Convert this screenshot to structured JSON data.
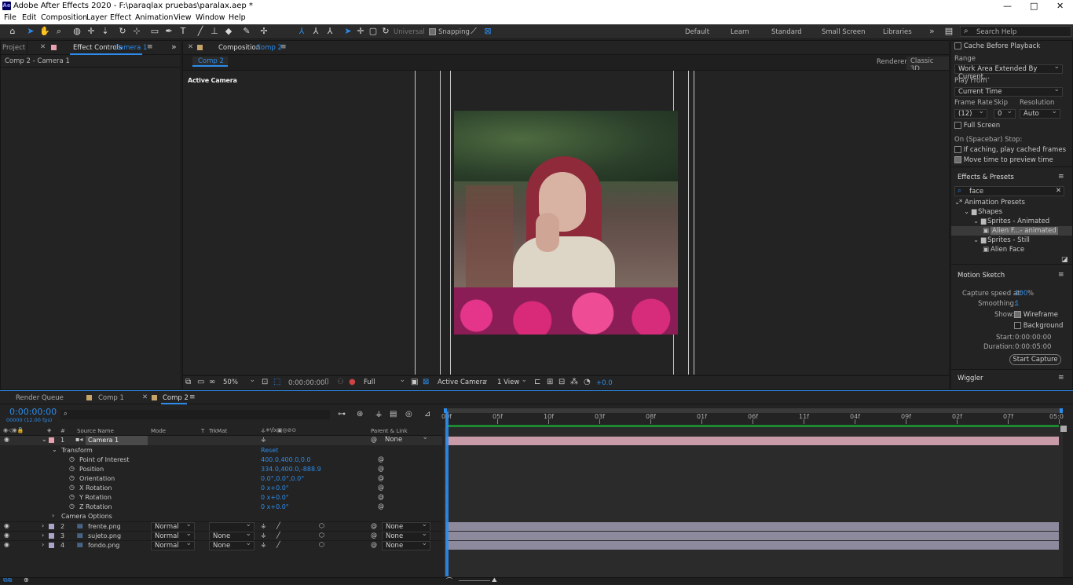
{
  "window": {
    "title": "Adobe After Effects 2020 - F:\\paraqlax pruebas\\paralax.aep *",
    "app_icon": "Ae",
    "minimize": "—",
    "maximize": "□",
    "close": "✕"
  },
  "menu": [
    "File",
    "Edit",
    "Composition",
    "Layer",
    "Effect",
    "Animation",
    "View",
    "Window",
    "Help"
  ],
  "toolbar": {
    "universal": "Universal",
    "snapping": "Snapping",
    "workspaces": [
      "Default",
      "Learn",
      "Standard",
      "Small Screen",
      "Libraries"
    ],
    "more": "»",
    "search_placeholder": "Search Help"
  },
  "left_panel": {
    "project_tab": "Project",
    "effect_controls_tab": "Effect Controls",
    "effect_controls_target": "Camera 1",
    "subtitle": "Comp 2 - Camera 1"
  },
  "comp_panel": {
    "tab_prefix": "Composition",
    "tab_name": "Comp 2",
    "breadcrumb": "Comp 2",
    "renderer_label": "Renderer:",
    "renderer_value": "Classic 3D",
    "view_label": "Active Camera",
    "footer": {
      "zoom": "50%",
      "timecode": "0:00:00:00",
      "resolution": "Full",
      "camera": "Active Camera",
      "views": "1 View",
      "exposure": "+0.0"
    }
  },
  "preview": {
    "cache_before_playback": "Cache Before Playback",
    "range_label": "Range",
    "range_value": "Work Area Extended By Current...",
    "play_from_label": "Play From",
    "play_from_value": "Current Time",
    "frame_rate_label": "Frame Rate",
    "skip_label": "Skip",
    "resolution_label": "Resolution",
    "frame_rate_value": "(12)",
    "skip_value": "0",
    "resolution_value": "Auto",
    "full_screen": "Full Screen",
    "spacebar_stop": "On (Spacebar) Stop:",
    "if_caching": "If caching, play cached frames",
    "move_time": "Move time to preview time"
  },
  "effects_presets": {
    "title": "Effects & Presets",
    "search_value": "face",
    "tree": [
      {
        "label": "* Animation Presets",
        "indent": 0,
        "kind": "arrow"
      },
      {
        "label": "Shapes",
        "indent": 1,
        "kind": "folder"
      },
      {
        "label": "Sprites - Animated",
        "indent": 2,
        "kind": "folder"
      },
      {
        "label": "Alien F...- animated",
        "indent": 3,
        "kind": "item",
        "selected": true
      },
      {
        "label": "Sprites - Still",
        "indent": 2,
        "kind": "folder"
      },
      {
        "label": "Alien Face",
        "indent": 3,
        "kind": "item"
      }
    ]
  },
  "motion_sketch": {
    "title": "Motion Sketch",
    "capture_label": "Capture speed at:",
    "capture_value": "100",
    "capture_unit": "%",
    "smoothing_label": "Smoothing:",
    "smoothing_value": "1",
    "show_label": "Show:",
    "wireframe": "Wireframe",
    "background": "Background",
    "start_label": "Start:",
    "start_value": "0:00:00:00",
    "duration_label": "Duration:",
    "duration_value": "0:00:05:00",
    "button": "Start Capture"
  },
  "wiggler": {
    "title": "Wiggler"
  },
  "timeline": {
    "tabs": [
      "Render Queue",
      "Comp 1",
      "Comp 2"
    ],
    "timecode": "0:00:00:00",
    "fps": "00000 (12.00 fps)",
    "headers": {
      "num": "#",
      "source": "Source Name",
      "mode": "Mode",
      "t": "T",
      "trkmat": "TrkMat",
      "parent": "Parent & Link"
    },
    "ruler": [
      "00f",
      "05f",
      "10f",
      "03f",
      "08f",
      "01f",
      "06f",
      "11f",
      "04f",
      "09f",
      "02f",
      "07f",
      "05:0"
    ],
    "camera": {
      "num": "1",
      "name": "Camera 1",
      "parent": "None"
    },
    "transform": {
      "label": "Transform",
      "reset": "Reset",
      "props": [
        {
          "name": "Point of Interest",
          "value": "400.0,400.0,0.0"
        },
        {
          "name": "Position",
          "value": "334.0,400.0,-888.9"
        },
        {
          "name": "Orientation",
          "value": "0.0°,0.0°,0.0°"
        },
        {
          "name": "X Rotation",
          "value": "0 x+0.0°"
        },
        {
          "name": "Y Rotation",
          "value": "0 x+0.0°"
        },
        {
          "name": "Z Rotation",
          "value": "0 x+0.0°"
        }
      ]
    },
    "camera_options": "Camera Options",
    "layers": [
      {
        "num": "2",
        "name": "frente.png",
        "mode": "Normal",
        "trkmat": "",
        "parent": "None"
      },
      {
        "num": "3",
        "name": "sujeto.png",
        "mode": "Normal",
        "trkmat": "None",
        "parent": "None"
      },
      {
        "num": "4",
        "name": "fondo.png",
        "mode": "Normal",
        "trkmat": "None",
        "parent": "None"
      }
    ]
  },
  "colors": {
    "accent": "#2d8ceb",
    "camera_bar": "#c99aa8",
    "footage_bar": "#8e8a9e",
    "work_area": "#1d8a32"
  }
}
